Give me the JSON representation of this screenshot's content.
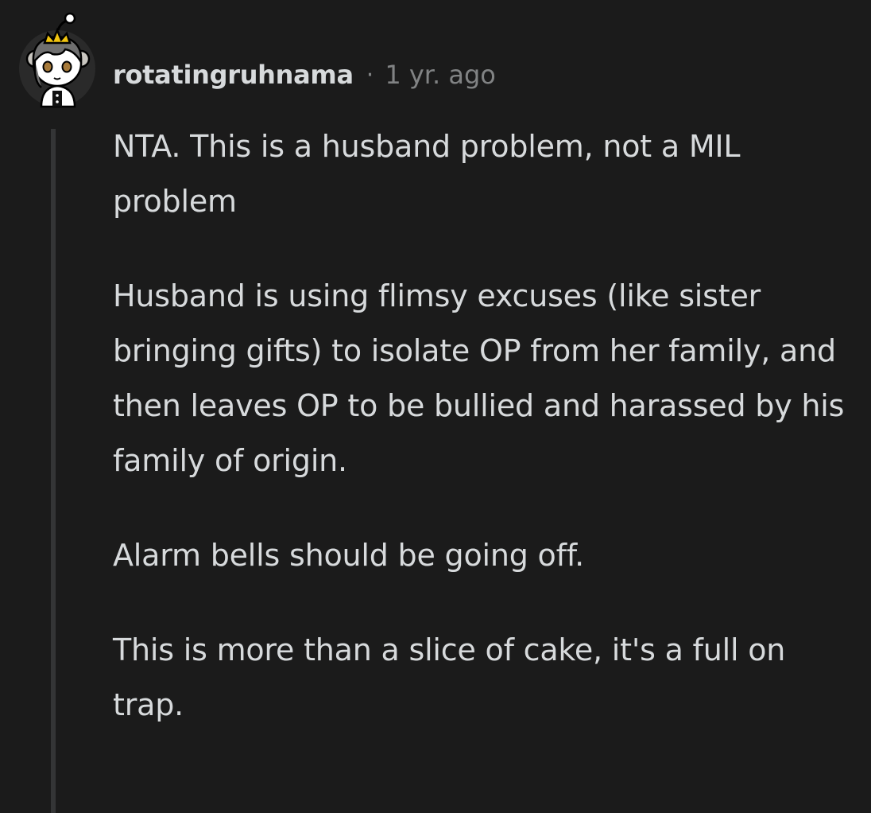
{
  "comment": {
    "author": "rotatingruhnama",
    "separator": "·",
    "timestamp": "1 yr. ago",
    "avatar_icon": "snoo-avatar-icon",
    "paragraphs": [
      "NTA. This is a husband problem, not a MIL problem",
      "Husband is using flimsy excuses (like sister bringing gifts) to isolate OP from her family, and then leaves OP to be bullied and harassed by his family of origin.",
      "Alarm bells should be going off.",
      "This is more than a slice of cake, it's a full on trap."
    ]
  },
  "colors": {
    "background": "#1b1b1b",
    "text": "#d7dadc",
    "meta": "#818384",
    "thread_line": "#343536"
  }
}
